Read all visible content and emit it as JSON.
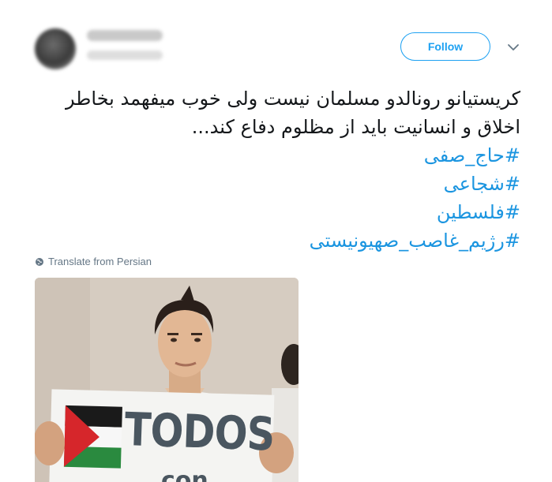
{
  "header": {
    "follow_label": "Follow"
  },
  "tweet": {
    "text_lines": [
      "کریستیانو رونالدو مسلمان نیست ولی خوب میفهمد بخاطر",
      "اخلاق و انسانیت باید از مظلوم دفاع کند..."
    ],
    "hashtags": [
      "#حاج_صفی",
      "#شجاعی",
      "#فلسطین",
      "#رژیم_غاصب_صهیونیستی"
    ],
    "translate_label": "Translate from Persian"
  },
  "photo": {
    "sign_text": "TODOS",
    "sign_text_partial": "con"
  },
  "colors": {
    "accent": "#1da1f2",
    "hashtag": "#1b95e0",
    "muted": "#657786"
  },
  "icons": {
    "caret": "chevron-down-icon",
    "translate": "globe-icon"
  }
}
